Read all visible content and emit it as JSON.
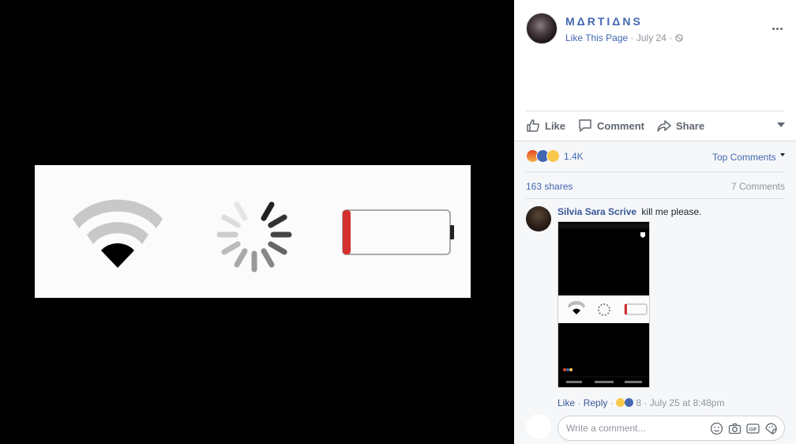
{
  "post": {
    "page_name": "MΔRTIΔNS",
    "like_page": "Like This Page",
    "date": "July 24",
    "separator": "·"
  },
  "actions": {
    "like": "Like",
    "comment": "Comment",
    "share": "Share"
  },
  "stats": {
    "reaction_count": "1.4K",
    "top_comments": "Top Comments",
    "shares": "163 shares",
    "comments": "7 Comments"
  },
  "comment": {
    "author": "Silvia Sara Scrive",
    "text": "kill me please.",
    "like": "Like",
    "reply": "Reply",
    "reaction_count": "8",
    "timestamp": "July 25 at 8:48pm"
  },
  "composer": {
    "placeholder": "Write a comment..."
  },
  "icons": {
    "more": "more-horizontal-icon",
    "privacy": "globe-icon",
    "wifi": "wifi-icon",
    "spinner": "loading-spinner-icon",
    "battery": "low-battery-icon"
  },
  "colors": {
    "link": "#4267b2",
    "battery_low": "#d32f2f",
    "wifi_active": "#000000"
  }
}
